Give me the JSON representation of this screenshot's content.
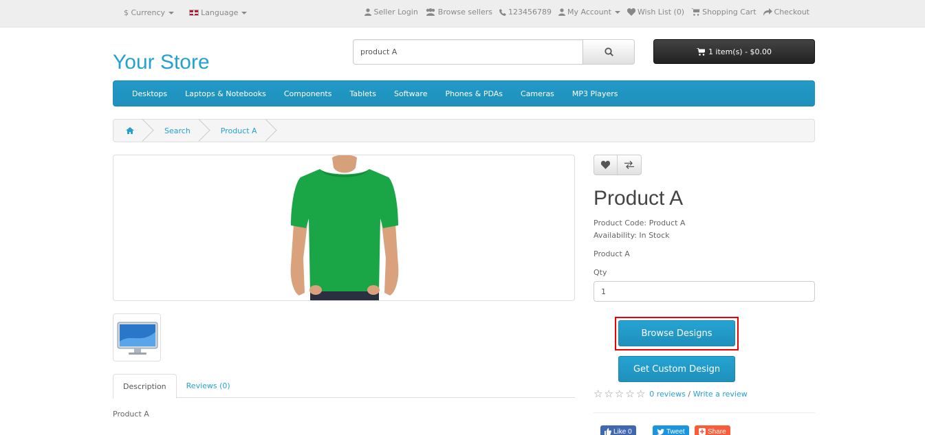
{
  "topbar": {
    "currency": "$ Currency",
    "language": "Language",
    "seller_login": "Seller Login",
    "browse_sellers": "Browse sellers",
    "phone": "123456789",
    "my_account": "My Account",
    "wish_list": "Wish List (0)",
    "shopping_cart": "Shopping Cart",
    "checkout": "Checkout"
  },
  "header": {
    "logo": "Your Store",
    "search_value": "product A",
    "cart_label": "1 item(s) - $0.00"
  },
  "menu": [
    "Desktops",
    "Laptops & Notebooks",
    "Components",
    "Tablets",
    "Software",
    "Phones & PDAs",
    "Cameras",
    "MP3 Players"
  ],
  "breadcrumb": {
    "search": "Search",
    "product": "Product A"
  },
  "product": {
    "title": "Product A",
    "code": "Product Code: Product A",
    "availability": "Availability: In Stock",
    "description_short": "Product A",
    "qty_label": "Qty",
    "qty_value": "1",
    "browse_designs": "Browse Designs",
    "custom_design": "Get Custom Design",
    "reviews_link": "0 reviews",
    "separator": " / ",
    "write_review": "Write a review"
  },
  "tabs": {
    "description": "Description",
    "reviews": "Reviews (0)",
    "content": "Product A"
  },
  "social": {
    "like": "Like 0",
    "tweet": "Tweet",
    "share": "Share"
  },
  "colors": {
    "accent": "#23a1d1",
    "menu": "#229ac8",
    "highlight": "#ee0000",
    "tshirt": "#1aa646"
  }
}
